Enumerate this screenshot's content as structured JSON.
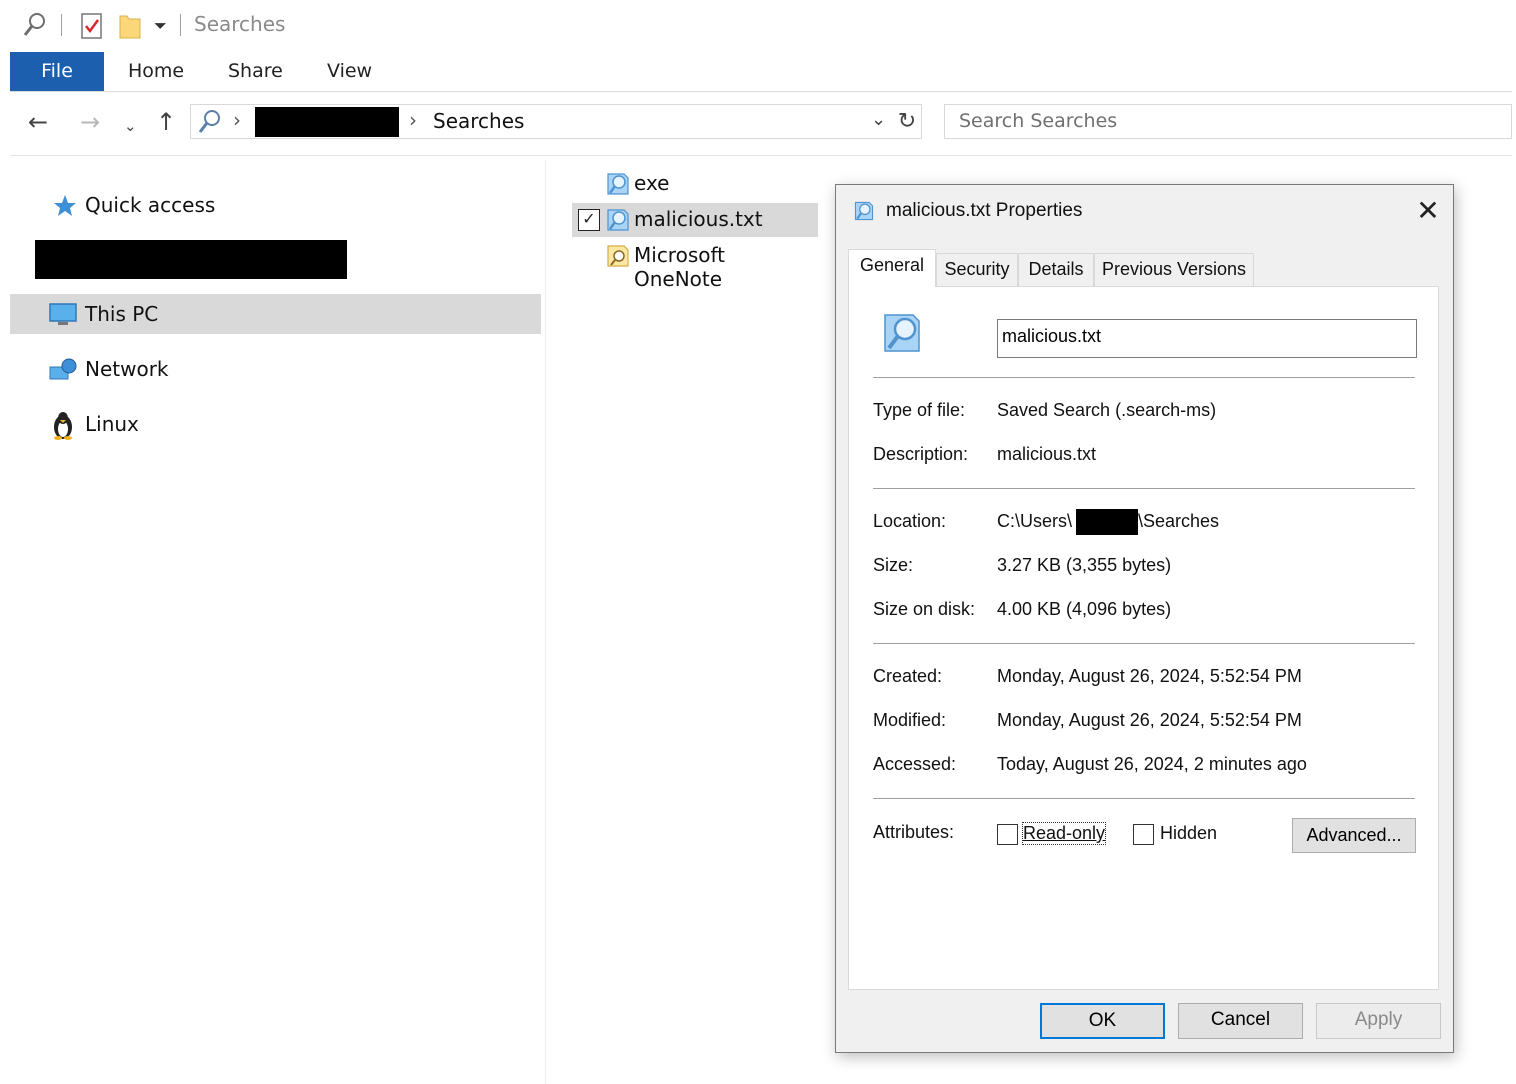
{
  "window": {
    "title": "Searches"
  },
  "ribbon": {
    "tabs": [
      "File",
      "Home",
      "Share",
      "View"
    ]
  },
  "address": {
    "location": "Searches",
    "search_placeholder": "Search Searches"
  },
  "sidebar": {
    "items": [
      {
        "label": "Quick access",
        "icon": "star-icon"
      },
      {
        "label": "This PC",
        "icon": "computer-icon"
      },
      {
        "label": "Network",
        "icon": "network-icon"
      },
      {
        "label": "Linux",
        "icon": "penguin-icon"
      }
    ]
  },
  "files": [
    {
      "name": "exe",
      "icon": "saved-search-icon",
      "selected": false
    },
    {
      "name": "malicious.txt",
      "icon": "saved-search-icon",
      "selected": true
    },
    {
      "name": "Microsoft OneNote",
      "icon": "folder-search-icon",
      "selected": false
    }
  ],
  "dialog": {
    "title": "malicious.txt Properties",
    "tabs": [
      "General",
      "Security",
      "Details",
      "Previous Versions"
    ],
    "name_value": "malicious.txt",
    "labels": {
      "type": "Type of file:",
      "description": "Description:",
      "location": "Location:",
      "size": "Size:",
      "size_on_disk": "Size on disk:",
      "created": "Created:",
      "modified": "Modified:",
      "accessed": "Accessed:",
      "attributes": "Attributes:"
    },
    "values": {
      "type": "Saved Search (.search-ms)",
      "description": "malicious.txt",
      "location_prefix": "C:\\Users\\",
      "location_suffix": "\\Searches",
      "size": "3.27 KB (3,355 bytes)",
      "size_on_disk": "4.00 KB (4,096 bytes)",
      "created": "Monday, August 26, 2024, 5:52:54 PM",
      "modified": "Monday, August 26, 2024, 5:52:54 PM",
      "accessed": "Today, August 26, 2024, 2 minutes ago"
    },
    "attributes": {
      "readonly": "Read-only",
      "hidden": "Hidden",
      "advanced": "Advanced..."
    },
    "buttons": {
      "ok": "OK",
      "cancel": "Cancel",
      "apply": "Apply"
    }
  }
}
